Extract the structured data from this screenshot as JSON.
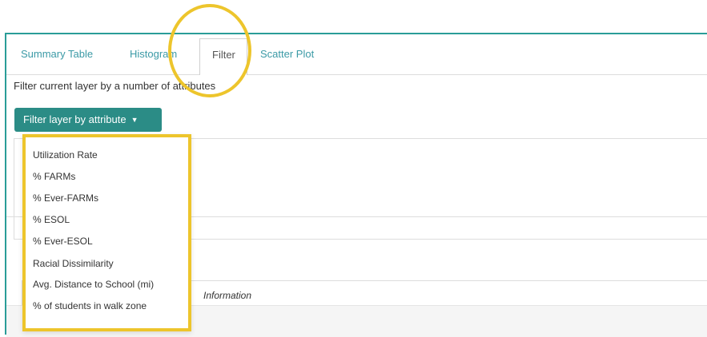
{
  "tabs": [
    {
      "label": "Summary Table"
    },
    {
      "label": "Histogram"
    },
    {
      "label": "Filter"
    },
    {
      "label": "Scatter Plot"
    }
  ],
  "hint_text": "Filter current layer by a number of attributes",
  "filter_button": {
    "label": "Filter layer by attribute"
  },
  "info_placeholder": "Information",
  "dropdown": {
    "items": [
      {
        "label": "Utilization Rate"
      },
      {
        "label": "% FARMs"
      },
      {
        "label": "% Ever-FARMs"
      },
      {
        "label": "% ESOL"
      },
      {
        "label": "% Ever-ESOL"
      },
      {
        "label": "Racial Dissimilarity"
      },
      {
        "label": "Avg. Distance to School (mi)"
      },
      {
        "label": "% of students in walk zone"
      }
    ]
  },
  "colors": {
    "accent": "#2b8c86",
    "tab_text": "#3b9aa6",
    "highlight": "#edc52c"
  },
  "icons": {
    "caret": "caret-down-icon"
  }
}
